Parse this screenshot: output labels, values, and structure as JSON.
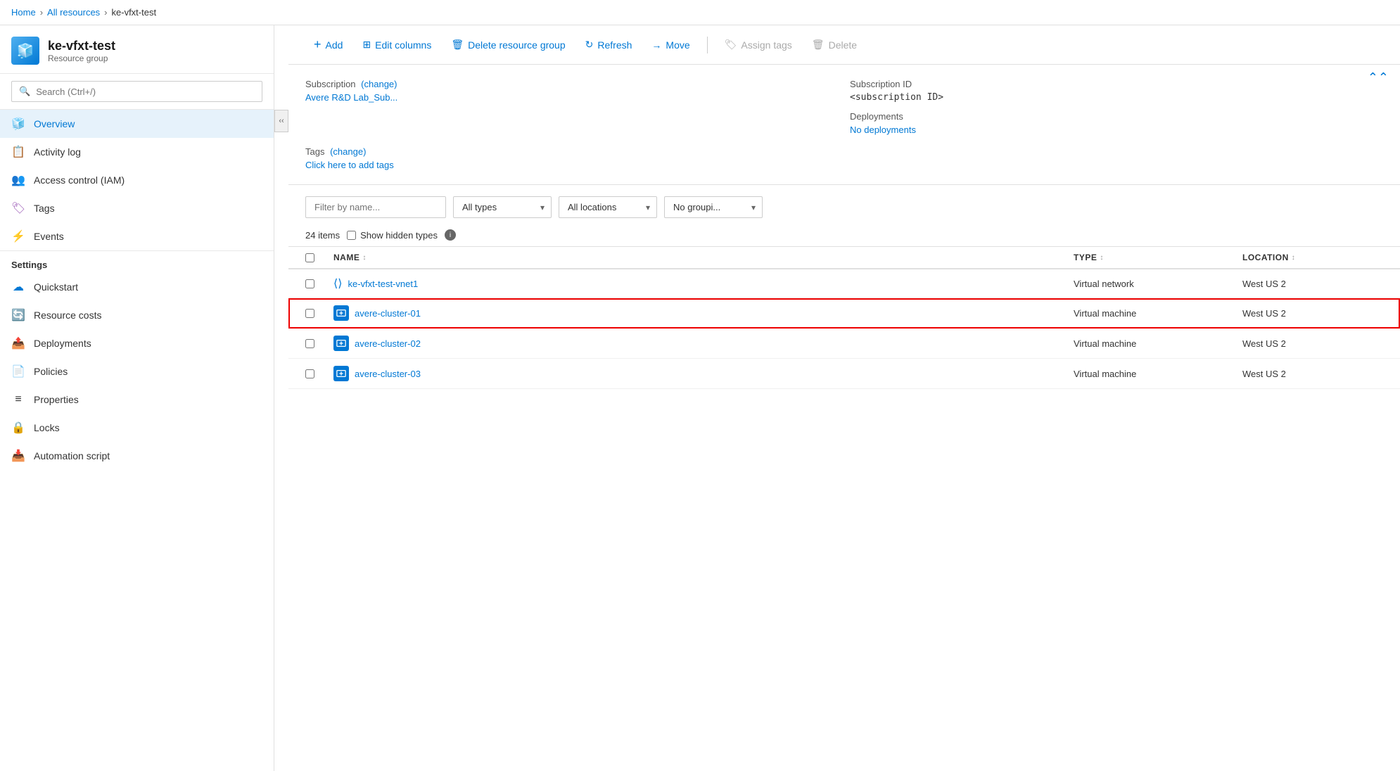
{
  "breadcrumb": {
    "home": "Home",
    "all_resources": "All resources",
    "current": "ke-vfxt-test"
  },
  "sidebar": {
    "resource_name": "ke-vfxt-test",
    "resource_type": "Resource group",
    "search_placeholder": "Search (Ctrl+/)",
    "nav_items": [
      {
        "id": "overview",
        "label": "Overview",
        "icon": "🧊",
        "active": true
      },
      {
        "id": "activity-log",
        "label": "Activity log",
        "icon": "📋"
      },
      {
        "id": "access-control",
        "label": "Access control (IAM)",
        "icon": "👥"
      },
      {
        "id": "tags",
        "label": "Tags",
        "icon": "🏷"
      },
      {
        "id": "events",
        "label": "Events",
        "icon": "⚡"
      }
    ],
    "settings_label": "Settings",
    "settings_items": [
      {
        "id": "quickstart",
        "label": "Quickstart",
        "icon": "☁"
      },
      {
        "id": "resource-costs",
        "label": "Resource costs",
        "icon": "🔄"
      },
      {
        "id": "deployments",
        "label": "Deployments",
        "icon": "📤"
      },
      {
        "id": "policies",
        "label": "Policies",
        "icon": "📄"
      },
      {
        "id": "properties",
        "label": "Properties",
        "icon": "≡"
      },
      {
        "id": "locks",
        "label": "Locks",
        "icon": "🔒"
      },
      {
        "id": "automation-script",
        "label": "Automation script",
        "icon": "📥"
      }
    ]
  },
  "toolbar": {
    "add_label": "Add",
    "edit_columns_label": "Edit columns",
    "delete_rg_label": "Delete resource group",
    "refresh_label": "Refresh",
    "move_label": "Move",
    "assign_tags_label": "Assign tags",
    "delete_label": "Delete"
  },
  "info_panel": {
    "subscription_label": "Subscription",
    "subscription_change": "(change)",
    "subscription_value": "Avere R&D Lab_Sub...",
    "subscription_id_label": "Subscription ID",
    "subscription_id_value": "<subscription ID>",
    "deployments_label": "Deployments",
    "deployments_value": "No deployments",
    "tags_label": "Tags",
    "tags_change": "(change)",
    "tags_add": "Click here to add tags"
  },
  "filters": {
    "filter_placeholder": "Filter by name...",
    "all_types_label": "All types",
    "all_locations_label": "All locations",
    "no_grouping_label": "No groupi...",
    "items_count": "24 items",
    "show_hidden_label": "Show hidden types"
  },
  "table": {
    "col_name": "NAME",
    "col_type": "TYPE",
    "col_location": "LOCATION",
    "rows": [
      {
        "id": "vnet1",
        "name": "ke-vfxt-test-vnet1",
        "type": "Virtual network",
        "location": "West US 2",
        "icon_type": "vnet",
        "highlighted": false
      },
      {
        "id": "avere-cluster-01",
        "name": "avere-cluster-01",
        "type": "Virtual machine",
        "location": "West US 2",
        "icon_type": "vm",
        "highlighted": true
      },
      {
        "id": "avere-cluster-02",
        "name": "avere-cluster-02",
        "type": "Virtual machine",
        "location": "West US 2",
        "icon_type": "vm",
        "highlighted": false
      },
      {
        "id": "avere-cluster-03",
        "name": "avere-cluster-03",
        "type": "Virtual machine",
        "location": "West US 2",
        "icon_type": "vm",
        "highlighted": false
      }
    ]
  },
  "colors": {
    "active_nav_bg": "#e6f2fb",
    "link_blue": "#0078d4",
    "highlight_red": "#cc0000",
    "border": "#e0e0e0"
  }
}
